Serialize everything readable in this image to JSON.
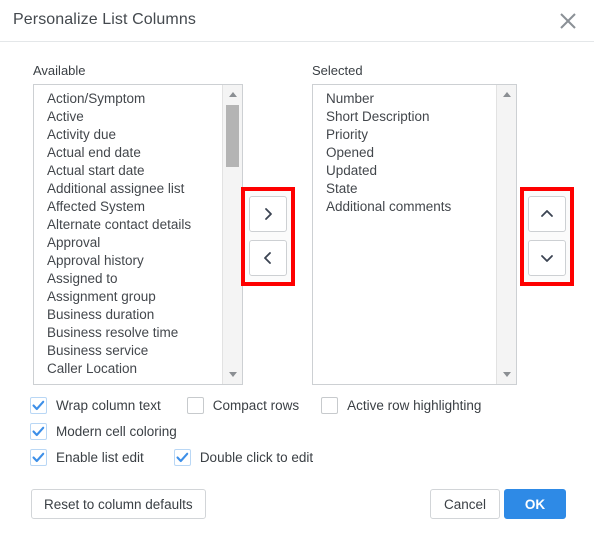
{
  "dialog": {
    "title": "Personalize List Columns",
    "close_icon": "close-icon"
  },
  "available": {
    "label": "Available",
    "items": [
      "Action/Symptom",
      "Active",
      "Activity due",
      "Actual end date",
      "Actual start date",
      "Additional assignee list",
      "Affected System",
      "Alternate contact details",
      "Approval",
      "Approval history",
      "Assigned to",
      "Assignment group",
      "Business duration",
      "Business resolve time",
      "Business service",
      "Caller Location"
    ],
    "scroll_up_icon": "triangle-up-icon",
    "scroll_down_icon": "triangle-down-icon"
  },
  "selected": {
    "label": "Selected",
    "items": [
      "Number",
      "Short Description",
      "Priority",
      "Opened",
      "Updated",
      "State",
      "Additional comments"
    ],
    "scroll_up_icon": "triangle-up-icon",
    "scroll_down_icon": "triangle-down-icon"
  },
  "move_buttons": {
    "add_icon": "chevron-right-icon",
    "remove_icon": "chevron-left-icon",
    "highlight_color": "#fe0000"
  },
  "order_buttons": {
    "move_up_icon": "chevron-up-icon",
    "move_down_icon": "chevron-down-icon",
    "highlight_color": "#fe0000"
  },
  "options": [
    {
      "label": "Wrap column text",
      "checked": true
    },
    {
      "label": "Compact rows",
      "checked": false
    },
    {
      "label": "Active row highlighting",
      "checked": false
    },
    {
      "label": "Modern cell coloring",
      "checked": true
    },
    {
      "label": "Enable list edit",
      "checked": true
    },
    {
      "label": "Double click to edit",
      "checked": true
    }
  ],
  "footer": {
    "reset_label": "Reset to column defaults",
    "cancel_label": "Cancel",
    "ok_label": "OK",
    "ok_color": "#2e8ae6"
  }
}
